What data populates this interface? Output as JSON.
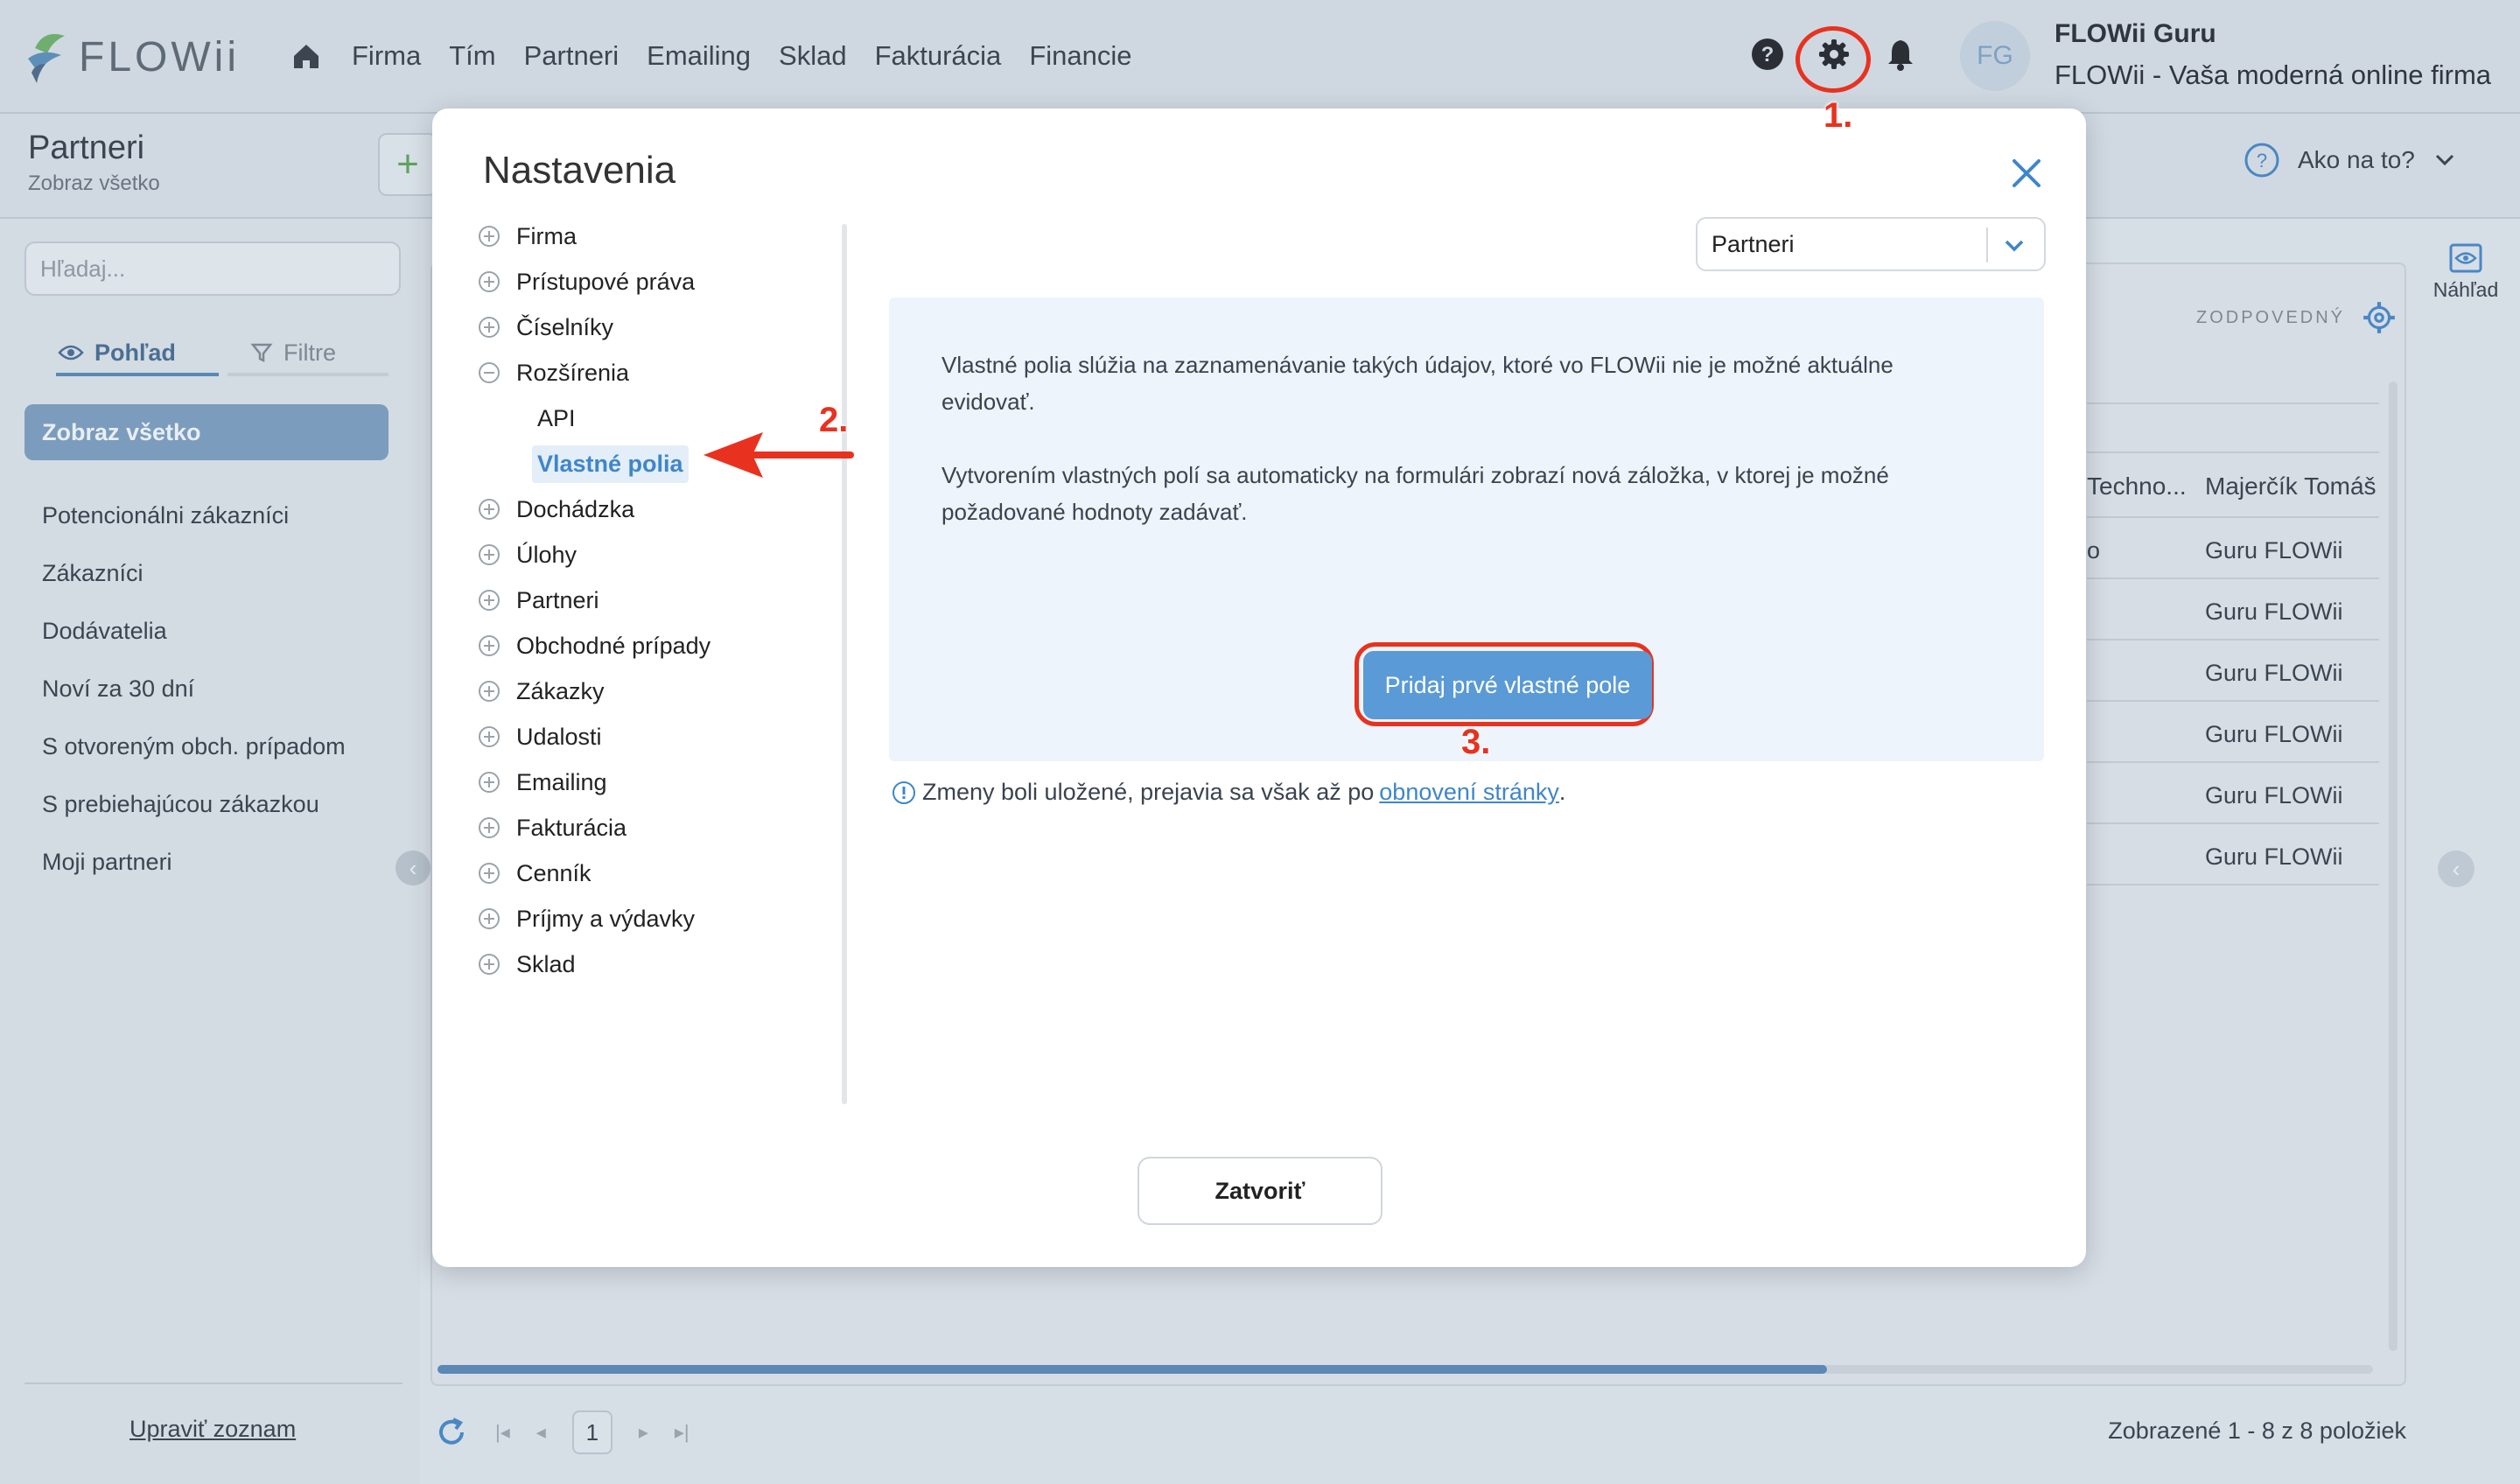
{
  "app": {
    "logo_text": "FLOWii",
    "nav": [
      "Firma",
      "Tím",
      "Partneri",
      "Emailing",
      "Sklad",
      "Fakturácia",
      "Financie"
    ],
    "user": {
      "initials": "FG",
      "name": "FLOWii Guru",
      "company": "FLOWii - Vaša moderná online firma"
    },
    "icons": [
      "help-icon",
      "gear-icon",
      "bell-icon"
    ]
  },
  "page": {
    "title": "Partneri",
    "subtitle": "Zobraz všetko",
    "help_label": "Ako na to?",
    "search_placeholder": "Hľadaj...",
    "view_tab": "Pohľad",
    "filter_tab": "Filtre",
    "selected_view": "Zobraz všetko",
    "views": [
      "Potencionálni zákazníci",
      "Zákazníci",
      "Dodávatelia",
      "Noví za 30 dní",
      "S otvoreným obch. prípadom",
      "S prebiehajúcou zákazkou",
      "Moji partneri"
    ],
    "edit_list": "Upraviť zoznam",
    "responsible_label": "ZODPOVEDNÝ",
    "preview_label": "Náhľad",
    "grid": {
      "header": {
        "col1": "Techno...",
        "col2": "Majerčík Tomáš"
      },
      "rows": [
        {
          "col1": "o",
          "col2": "Guru FLOWii"
        },
        {
          "col1": "",
          "col2": "Guru FLOWii"
        },
        {
          "col1": "",
          "col2": "Guru FLOWii"
        },
        {
          "col1": "",
          "col2": "Guru FLOWii"
        },
        {
          "col1": "",
          "col2": "Guru FLOWii"
        },
        {
          "col1": "",
          "col2": "Guru FLOWii"
        }
      ]
    },
    "pager": {
      "current_page": "1",
      "summary": "Zobrazené 1 - 8 z 8 položiek"
    }
  },
  "modal": {
    "title": "Nastavenia",
    "tree": [
      {
        "label": "Firma",
        "state": "collapsed"
      },
      {
        "label": "Prístupové práva",
        "state": "collapsed"
      },
      {
        "label": "Číselníky",
        "state": "collapsed"
      },
      {
        "label": "Rozšírenia",
        "state": "expanded",
        "children": [
          "API",
          "Vlastné polia"
        ],
        "active_child": "Vlastné polia"
      },
      {
        "label": "Dochádzka",
        "state": "collapsed"
      },
      {
        "label": "Úlohy",
        "state": "collapsed"
      },
      {
        "label": "Partneri",
        "state": "collapsed"
      },
      {
        "label": "Obchodné prípady",
        "state": "collapsed"
      },
      {
        "label": "Zákazky",
        "state": "collapsed"
      },
      {
        "label": "Udalosti",
        "state": "collapsed"
      },
      {
        "label": "Emailing",
        "state": "collapsed"
      },
      {
        "label": "Fakturácia",
        "state": "collapsed"
      },
      {
        "label": "Cenník",
        "state": "collapsed"
      },
      {
        "label": "Príjmy a výdavky",
        "state": "collapsed"
      },
      {
        "label": "Sklad",
        "state": "collapsed"
      }
    ],
    "entity_select": "Partneri",
    "info_text_1": "Vlastné polia slúžia na zaznamenávanie takých údajov, ktoré vo FLOWii nie je možné aktuálne evidovať.",
    "info_text_2": "Vytvorením vlastných polí sa automaticky na formulári zobrazí nová záložka, v ktorej je možné požadované hodnoty zadávať.",
    "add_button": "Pridaj prvé vlastné pole",
    "notice_text": "Zmeny boli uložené, prejavia sa však až po",
    "notice_link": "obnovení stránky",
    "notice_end": ".",
    "close_button": "Zatvoriť"
  },
  "annotations": {
    "step1": "1.",
    "step2": "2.",
    "step3": "3.",
    "color": "#e8321f"
  },
  "colors": {
    "accent": "#5a9ad6",
    "highlight_bg": "#e3eef8",
    "info_bg": "#edf4fb"
  }
}
